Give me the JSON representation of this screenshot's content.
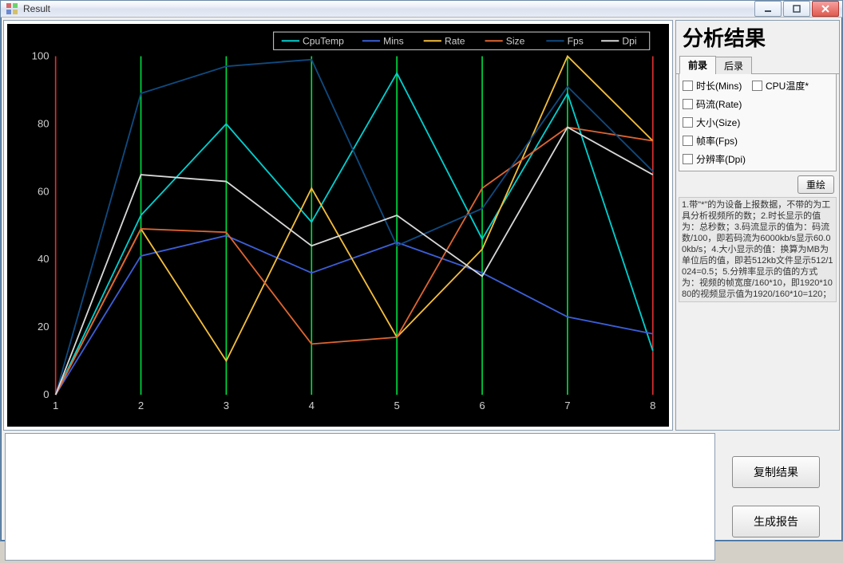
{
  "window": {
    "title": "Result"
  },
  "sidebar": {
    "header": "分析结果",
    "tabs": [
      {
        "id": "front",
        "label": "前录",
        "active": true
      },
      {
        "id": "back",
        "label": "后录",
        "active": false
      }
    ],
    "checkboxes_left": [
      {
        "label": "时长(Mins)"
      },
      {
        "label": "码流(Rate)"
      },
      {
        "label": "大小(Size)"
      },
      {
        "label": "帧率(Fps)"
      },
      {
        "label": "分辨率(Dpi)"
      }
    ],
    "checkboxes_right": [
      {
        "label": "CPU温度*"
      }
    ],
    "redraw_label": "重绘",
    "help_text": "1.带\"*\"的为设备上报数据，不带的为工具分析视频所的数；2.时长显示的值为：总秒数；3.码流显示的值为：码流数/100，即若码流为6000kb/s显示60.00kb/s；4.大小显示的值：换算为MB为单位后的值，即若512kb文件显示512/1024=0.5；5.分辨率显示的值的方式为：视频的帧宽度/160*10，即1920*1080的视频显示值为1920/160*10=120；"
  },
  "buttons": {
    "copy": "复制结果",
    "report": "生成报告"
  },
  "chart_data": {
    "type": "line",
    "xlabel": "",
    "ylabel": "",
    "x_ticks": [
      1,
      2,
      3,
      4,
      5,
      6,
      7,
      8
    ],
    "y_ticks": [
      0,
      20,
      40,
      60,
      80,
      100
    ],
    "ylim": [
      0,
      100
    ],
    "legend": [
      "CpuTemp",
      "Mins",
      "Rate",
      "Size",
      "Fps",
      "Dpi"
    ],
    "colors": {
      "CpuTemp": "#00d0d0",
      "Mins": "#3b5fd8",
      "Rate": "#f4be3b",
      "Size": "#e06530",
      "Fps": "#0f4a80",
      "Dpi": "#d8d8d8"
    },
    "series": [
      {
        "name": "CpuTemp",
        "x": [
          1,
          2,
          3,
          4,
          5,
          6,
          7,
          8
        ],
        "values": [
          0,
          53,
          80,
          51,
          95,
          46,
          89,
          13
        ]
      },
      {
        "name": "Mins",
        "x": [
          1,
          2,
          3,
          4,
          5,
          6,
          7,
          8
        ],
        "values": [
          0,
          41,
          47,
          36,
          45,
          36,
          23,
          18
        ]
      },
      {
        "name": "Rate",
        "x": [
          1,
          2,
          3,
          4,
          5,
          6,
          7,
          8
        ],
        "values": [
          0,
          49,
          10,
          61,
          17,
          43,
          100,
          75
        ]
      },
      {
        "name": "Size",
        "x": [
          1,
          2,
          3,
          4,
          5,
          6,
          7,
          8
        ],
        "values": [
          0,
          49,
          48,
          15,
          17,
          61,
          79,
          75
        ]
      },
      {
        "name": "Fps",
        "x": [
          1,
          2,
          3,
          4,
          5,
          6,
          7,
          8
        ],
        "values": [
          0,
          89,
          97,
          99,
          44,
          55,
          91,
          66
        ]
      },
      {
        "name": "Dpi",
        "x": [
          1,
          2,
          3,
          4,
          5,
          6,
          7,
          8
        ],
        "values": [
          0,
          65,
          63,
          44,
          53,
          35,
          79,
          65
        ]
      }
    ],
    "vertical_markers": [
      {
        "x": 1,
        "color": "#e03030"
      },
      {
        "x": 2,
        "color": "#00e040"
      },
      {
        "x": 3,
        "color": "#00e040"
      },
      {
        "x": 4,
        "color": "#00e040"
      },
      {
        "x": 5,
        "color": "#00e040"
      },
      {
        "x": 6,
        "color": "#00e040"
      },
      {
        "x": 7,
        "color": "#00e040"
      },
      {
        "x": 8,
        "color": "#e03030"
      }
    ]
  }
}
